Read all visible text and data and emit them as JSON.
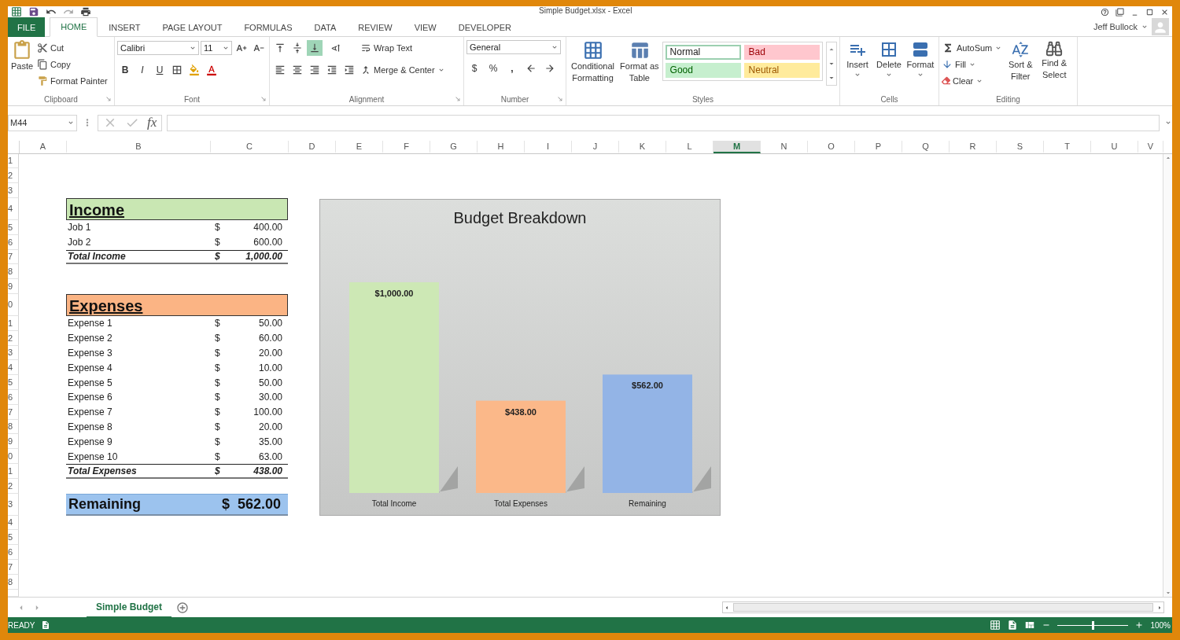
{
  "title_bar": {
    "title": "Simple Budget.xlsx - Excel",
    "user": "Jeff Bullock"
  },
  "ribbon_tabs": [
    {
      "label": "FILE",
      "kind": "file",
      "selected": false
    },
    {
      "label": "HOME",
      "kind": "tab",
      "selected": true
    },
    {
      "label": "INSERT",
      "kind": "tab",
      "selected": false
    },
    {
      "label": "PAGE LAYOUT",
      "kind": "tab",
      "selected": false
    },
    {
      "label": "FORMULAS",
      "kind": "tab",
      "selected": false
    },
    {
      "label": "DATA",
      "kind": "tab",
      "selected": false
    },
    {
      "label": "REVIEW",
      "kind": "tab",
      "selected": false
    },
    {
      "label": "VIEW",
      "kind": "tab",
      "selected": false
    },
    {
      "label": "DEVELOPER",
      "kind": "tab",
      "selected": false
    }
  ],
  "ribbon": {
    "clipboard": {
      "label": "Clipboard",
      "paste": "Paste",
      "cut": "Cut",
      "copy": "Copy",
      "format_painter": "Format Painter"
    },
    "font": {
      "label": "Font",
      "font_name": "Calibri",
      "font_size": "11",
      "bold": "B",
      "italic": "I",
      "underline": "U"
    },
    "alignment": {
      "label": "Alignment",
      "wrap_text": "Wrap Text",
      "merge": "Merge & Center"
    },
    "number": {
      "label": "Number",
      "format": "General",
      "currency": "$",
      "percent": "%",
      "comma": ","
    },
    "styles": {
      "label": "Styles",
      "conditional": "Conditional Formatting",
      "format_table": "Format as Table",
      "cell_styles": [
        {
          "label": "Normal",
          "kind": "normal",
          "color": "#ffffff",
          "selected": true
        },
        {
          "label": "Bad",
          "kind": "bad",
          "color": "#ffc7ce",
          "selected": false
        },
        {
          "label": "Good",
          "kind": "good",
          "color": "#c6efce",
          "selected": false
        },
        {
          "label": "Neutral",
          "kind": "neutral",
          "color": "#ffeb9c",
          "selected": false
        }
      ]
    },
    "cells": {
      "label": "Cells",
      "buttons": [
        "Insert",
        "Delete",
        "Format"
      ]
    },
    "editing": {
      "label": "Editing",
      "autosum": "AutoSum",
      "fill": "Fill",
      "clear": "Clear",
      "sort": "Sort & Filter",
      "find": "Find & Select"
    }
  },
  "formula_bar": {
    "name_box": "M44",
    "fx": "fx"
  },
  "columns": [
    {
      "label": "A",
      "selected": false
    },
    {
      "label": "B",
      "selected": false
    },
    {
      "label": "C",
      "selected": false
    },
    {
      "label": "D",
      "selected": false
    },
    {
      "label": "E",
      "selected": false
    },
    {
      "label": "F",
      "selected": false
    },
    {
      "label": "G",
      "selected": false
    },
    {
      "label": "H",
      "selected": false
    },
    {
      "label": "I",
      "selected": false
    },
    {
      "label": "J",
      "selected": false
    },
    {
      "label": "K",
      "selected": false
    },
    {
      "label": "L",
      "selected": false
    },
    {
      "label": "M",
      "selected": true
    },
    {
      "label": "N",
      "selected": false
    },
    {
      "label": "O",
      "selected": false
    },
    {
      "label": "P",
      "selected": false
    },
    {
      "label": "Q",
      "selected": false
    },
    {
      "label": "R",
      "selected": false
    },
    {
      "label": "S",
      "selected": false
    },
    {
      "label": "T",
      "selected": false
    },
    {
      "label": "U",
      "selected": false
    },
    {
      "label": "V",
      "selected": false
    }
  ],
  "rows": [
    "1",
    "2",
    "3",
    "4",
    "5",
    "6",
    "7",
    "8",
    "9",
    "0",
    "1",
    "2",
    "3",
    "4",
    "5",
    "6",
    "7",
    "8",
    "9",
    "0",
    "1",
    "2",
    "3",
    "4",
    "5",
    "6",
    "7",
    "8"
  ],
  "budget": {
    "income": {
      "title": "Income",
      "color": "#c9e7b3",
      "items": [
        {
          "label": "Job 1",
          "currency": "$",
          "amount": "400.00"
        },
        {
          "label": "Job 2",
          "currency": "$",
          "amount": "600.00"
        }
      ],
      "total": {
        "label": "Total Income",
        "currency": "$",
        "amount": "1,000.00"
      }
    },
    "expenses": {
      "title": "Expenses",
      "color": "#fbb484",
      "items": [
        {
          "label": "Expense 1",
          "currency": "$",
          "amount": "50.00"
        },
        {
          "label": "Expense 2",
          "currency": "$",
          "amount": "60.00"
        },
        {
          "label": "Expense 3",
          "currency": "$",
          "amount": "20.00"
        },
        {
          "label": "Expense 4",
          "currency": "$",
          "amount": "10.00"
        },
        {
          "label": "Expense 5",
          "currency": "$",
          "amount": "50.00"
        },
        {
          "label": "Expense 6",
          "currency": "$",
          "amount": "30.00"
        },
        {
          "label": "Expense 7",
          "currency": "$",
          "amount": "100.00"
        },
        {
          "label": "Expense 8",
          "currency": "$",
          "amount": "20.00"
        },
        {
          "label": "Expense 9",
          "currency": "$",
          "amount": "35.00"
        },
        {
          "label": "Expense 10",
          "currency": "$",
          "amount": "63.00"
        }
      ],
      "total": {
        "label": "Total Expenses",
        "currency": "$",
        "amount": "438.00"
      }
    },
    "remaining": {
      "label": "Remaining",
      "currency": "$",
      "amount": "562.00",
      "color": "#9cc3ee"
    }
  },
  "chart": {
    "bars": [
      {
        "color": "#cde8b5"
      },
      {
        "color": "#fbb889"
      },
      {
        "color": "#93b4e6"
      }
    ],
    "chart_data": {
      "type": "bar",
      "title": "Budget Breakdown",
      "categories": [
        "Total Income",
        "Total Expenses",
        "Remaining"
      ],
      "values": [
        1000,
        438,
        562
      ],
      "value_labels": [
        "$1,000.00",
        "$438.00",
        "$562.00"
      ]
    }
  },
  "sheet_tabs": [
    {
      "label": "Simple Budget",
      "selected": true
    }
  ],
  "status_bar": {
    "status": "READY",
    "zoom": "100%",
    "zoom_slider": {
      "level": 0.5
    }
  }
}
